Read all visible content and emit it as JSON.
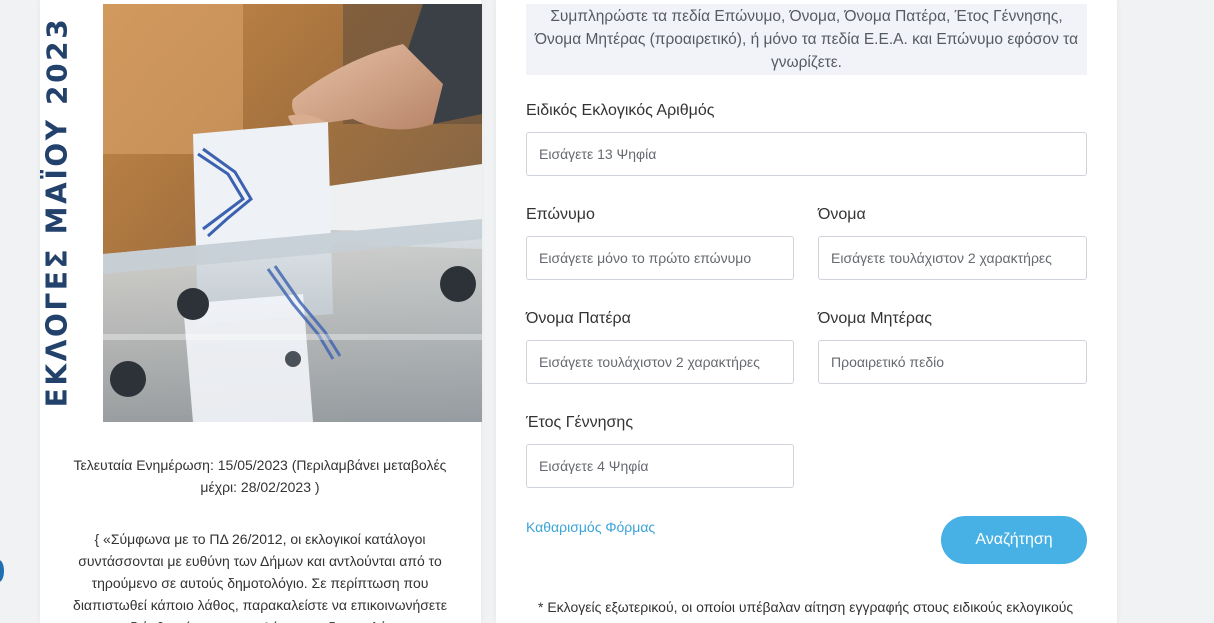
{
  "side_title": "ΕΚΛΟΓΕΣ ΜΑΪΟΥ 2023",
  "last_update": "Τελευταία Ενημέρωση: 15/05/2023 (Περιλαμβάνει μεταβολές μέχρι: 28/02/2023 )",
  "notice": "{ «Σύμφωνα με το ΠΔ 26/2012, οι εκλογικοί κατάλογοι συντάσσονται με ευθύνη των Δήμων και αντλούνται από το τηρούμενο σε αυτούς δημοτολόγιο. Σε περίπτωση που διαπιστωθεί κάποιο λάθος, παρακαλείστε να επικοινωνήσετε για τη διόρθωσή του με τον Δήμο, στο δημοτολόγιο του",
  "form": {
    "instructions": "Συμπληρώστε τα πεδία Επώνυμο, Όνομα, Όνομα Πατέρα, Έτος Γέννησης, Όνομα Μητέρας (προαιρετικό), ή μόνο τα πεδία Ε.Ε.Α. και Επώνυμο εφόσον τα γνωρίζετε.",
    "eea": {
      "label": "Ειδικός Εκλογικός Αριθμός",
      "placeholder": "Εισάγετε 13 Ψηφία",
      "value": ""
    },
    "surname": {
      "label": "Επώνυμο",
      "placeholder": "Εισάγετε μόνο το πρώτο επώνυμο",
      "value": ""
    },
    "name": {
      "label": "Όνομα",
      "placeholder": "Εισάγετε τουλάχιστον 2 χαρακτήρες",
      "value": ""
    },
    "father_name": {
      "label": "Όνομα Πατέρα",
      "placeholder": "Εισάγετε τουλάχιστον 2 χαρακτήρες",
      "value": ""
    },
    "mother_name": {
      "label": "Όνομα Μητέρας",
      "placeholder": "Προαιρετικό πεδίο",
      "value": ""
    },
    "birth_year": {
      "label": "Έτος Γέννησης",
      "placeholder": "Εισάγετε 4 Ψηφία",
      "value": ""
    },
    "clear_label": "Καθαρισμός Φόρμας",
    "search_label": "Αναζήτηση"
  },
  "footnote": "* Εκλογείς εξωτερικού, οι οποίοι υπέβαλαν αίτηση εγγραφής στους ειδικούς εκλογικούς",
  "colors": {
    "title": "#22416b",
    "accent": "#47b0e4",
    "link": "#3aa3d8",
    "info_bg": "#f2f3f8"
  },
  "icons": {
    "photo": "ballot-box-photo"
  }
}
